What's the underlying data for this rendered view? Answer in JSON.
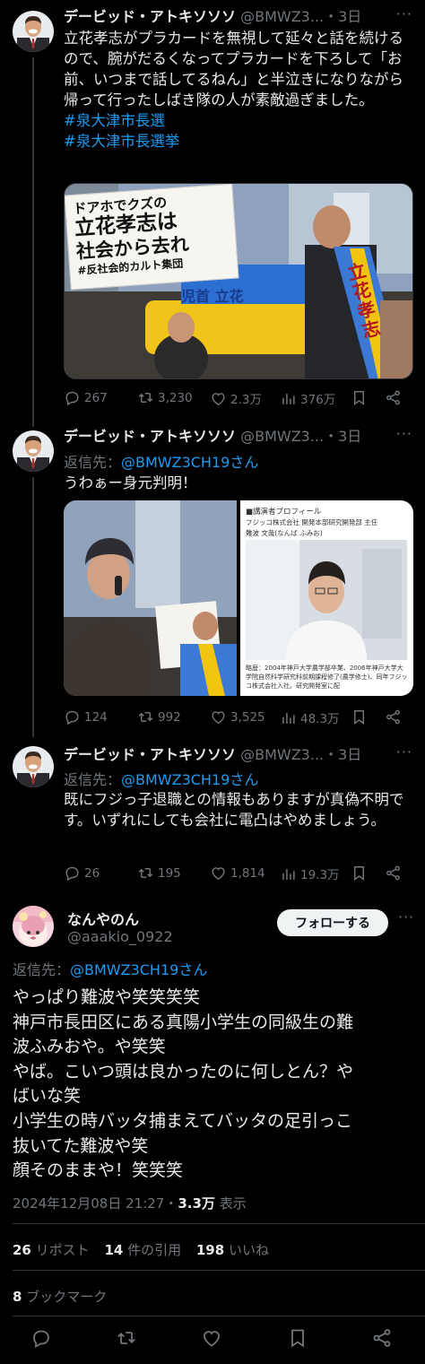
{
  "tweets": [
    {
      "name": "デービッド・アトキソソソ",
      "handle": "@BMWZ3...",
      "time": "・3日",
      "text": "立花孝志がプラカードを無視して延々と話を続けるので、腕がだるくなってプラカードを下ろして「お前、いつまで話してるねん」と半泣きになりながら帰って行ったしばき隊の人が素敵過ぎました。",
      "hashtags": [
        "#泉大津市長選",
        "#泉大津市長選挙"
      ],
      "placard": {
        "line1": "ドアホでクズの",
        "line2": "立花孝志は",
        "line3": "社会から去れ",
        "line4": "#反社会的カルト集団"
      },
      "sash_text": "立花孝志",
      "banner_text": "児首 立花",
      "replies": "267",
      "retweets": "3,230",
      "likes": "2.3万",
      "views": "376万"
    },
    {
      "name": "デービッド・アトキソソソ",
      "handle": "@BMWZ3...",
      "time": "・3日",
      "reply_prefix": "返信先：",
      "reply_mention": "@BMWZ3CH19さん",
      "text": "うわぁー身元判明！",
      "profile_card": {
        "header": "■講演者プロフィール",
        "company": "フジッコ株式会社 開発本部研究開発部 主任",
        "name": "難波 文哉(なんば ふみお)",
        "career": "略歴：2004年神戸大学農学部卒業、2006年神戸大学大学院自然科学研究科前期課程修了(農学修士)、同年フジッコ株式会社入社。研究開発室に配"
      },
      "replies": "124",
      "retweets": "992",
      "likes": "3,525",
      "views": "48.3万"
    },
    {
      "name": "デービッド・アトキソソソ",
      "handle": "@BMWZ3...",
      "time": "・3日",
      "reply_prefix": "返信先：",
      "reply_mention": "@BMWZ3CH19さん",
      "text": "既にフジっ子退職との情報もありますが真偽不明です。いずれにしても会社に電凸はやめましょう。",
      "replies": "26",
      "retweets": "195",
      "likes": "1,814",
      "views": "19.3万"
    }
  ],
  "main": {
    "name": "なんやのん",
    "handle": "@aaakio_0922",
    "follow_label": "フォローする",
    "reply_prefix": "返信先：",
    "reply_mention": "@BMWZ3CH19さん",
    "lines": [
      "やっぱり難波や笑笑笑笑",
      "神戸市長田区にある真陽小学生の同級生の難",
      "波ふみおや。や笑笑",
      "やば。こいつ頭は良かったのに何しとん？や",
      "ばいな笑",
      "小学生の時バッタ捕まえてバッタの足引っこ",
      "抜いてた難波や笑",
      "顔そのままや！笑笑笑"
    ],
    "timestamp": "2024年12月08日 21:27・",
    "views": "3.3万",
    "views_label": " 表示",
    "reposts": "26",
    "reposts_label": " リポスト",
    "quotes": "14",
    "quotes_label": " 件の引用",
    "likes": "198",
    "likes_label": " いいね",
    "bookmarks": "8",
    "bookmarks_label": " ブックマーク"
  },
  "colors": {
    "background": "#000000",
    "text": "#e7e9ea",
    "muted": "#71767b",
    "link": "#1d9bf0",
    "divider": "#2f3336"
  },
  "icons": [
    "reply-icon",
    "retweet-icon",
    "like-icon",
    "views-icon",
    "bookmark-icon",
    "share-icon",
    "more-icon"
  ]
}
